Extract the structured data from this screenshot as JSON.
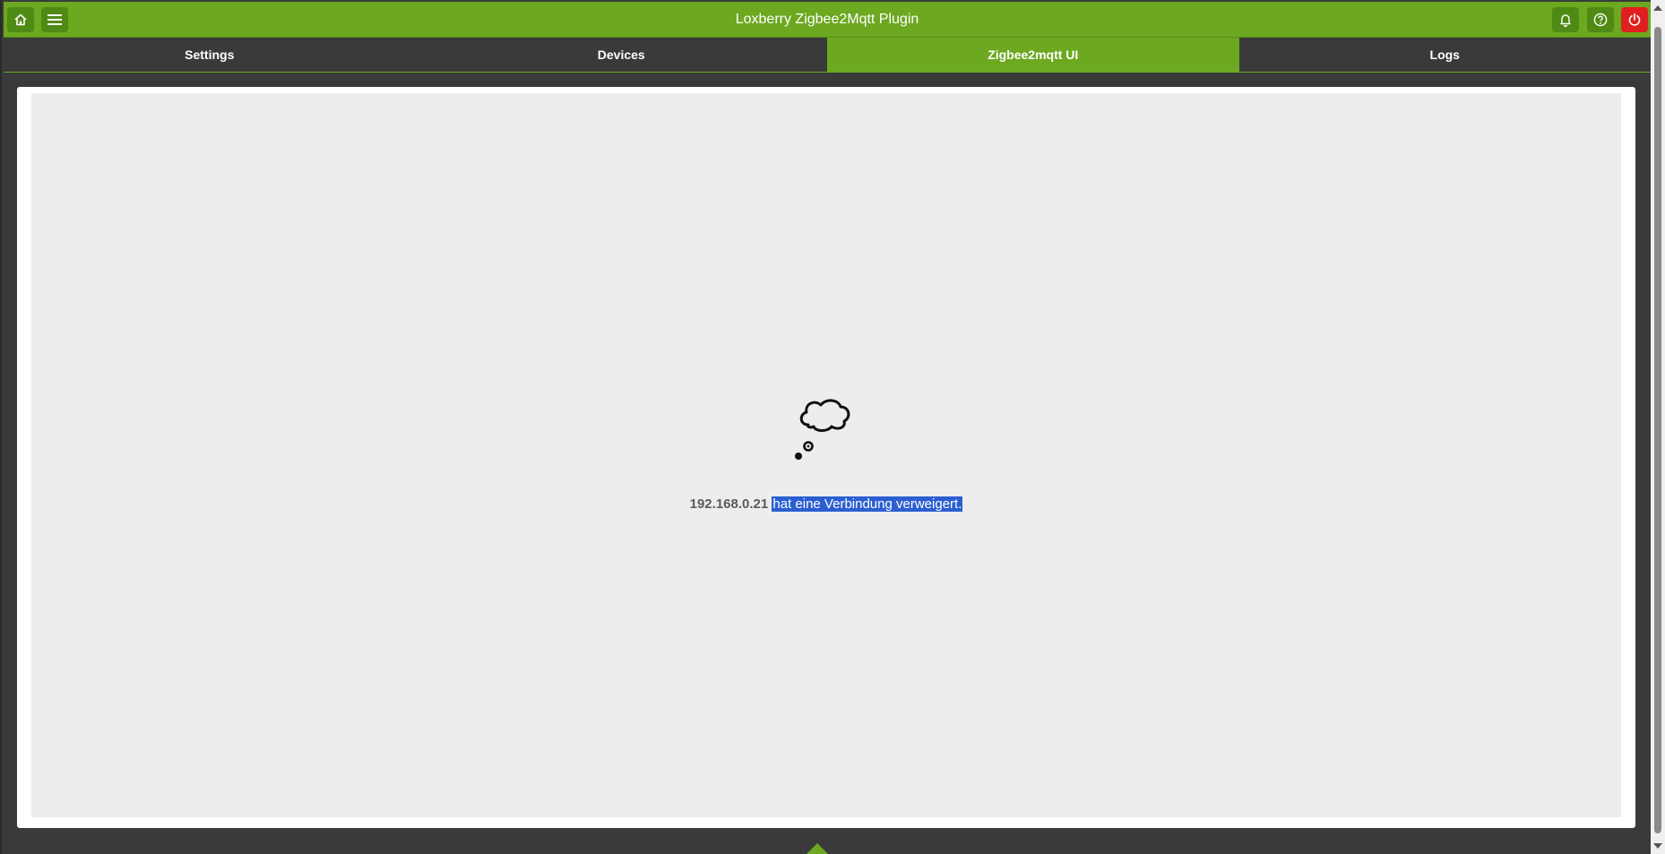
{
  "window": {
    "title": "Loxberry Zigbee2Mqtt Plugin"
  },
  "topbar": {
    "left_icons": [
      "home-icon",
      "menu-icon"
    ],
    "right_icons": [
      "bell-icon",
      "help-icon",
      "power-icon"
    ]
  },
  "tabs": [
    {
      "label": "Settings",
      "active": false
    },
    {
      "label": "Devices",
      "active": false
    },
    {
      "label": "Zigbee2mqtt UI",
      "active": true
    },
    {
      "label": "Logs",
      "active": false
    }
  ],
  "error": {
    "icon": "thought-cloud-icon",
    "host": "192.168.0.21",
    "message": "hat eine Verbindung verweigert."
  },
  "colors": {
    "accent": "#6ca820",
    "power": "#e02020",
    "selection": "#2b5fd1",
    "background": "#3a3a3a"
  }
}
